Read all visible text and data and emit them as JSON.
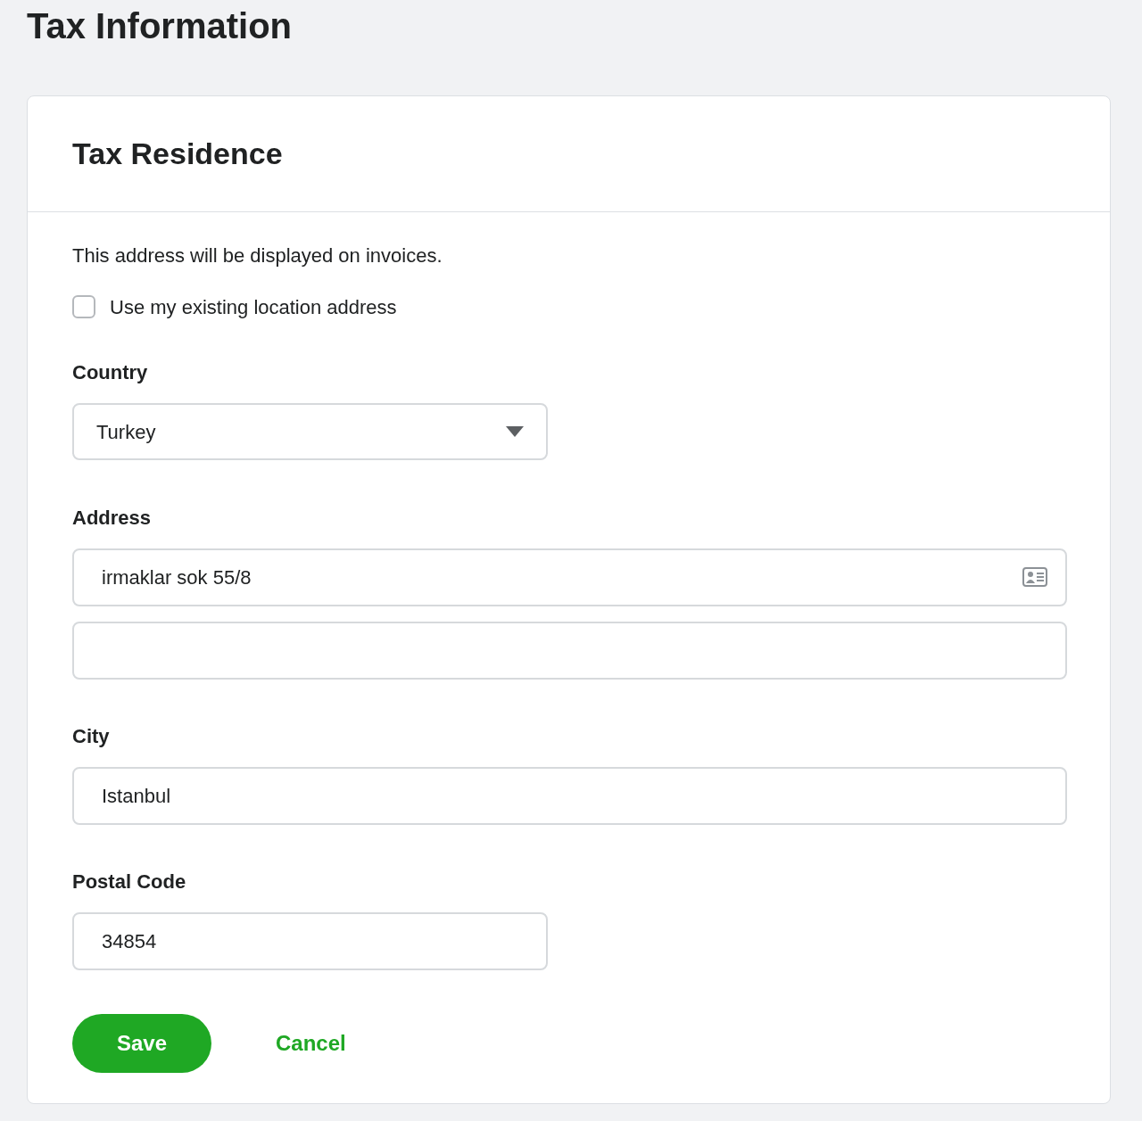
{
  "page_title": "Tax Information",
  "card": {
    "title": "Tax Residence",
    "description": "This address will be displayed on invoices.",
    "use_existing_address": {
      "label": "Use my existing location address",
      "checked": false
    },
    "country": {
      "label": "Country",
      "value": "Turkey"
    },
    "address": {
      "label": "Address",
      "line_1": "irmaklar sok 55/8"
    },
    "city": {
      "label": "City",
      "value": "Istanbul"
    },
    "postal_code": {
      "label": "Postal Code",
      "value": "34854"
    },
    "buttons": {
      "save": "Save",
      "cancel": "Cancel"
    }
  }
}
